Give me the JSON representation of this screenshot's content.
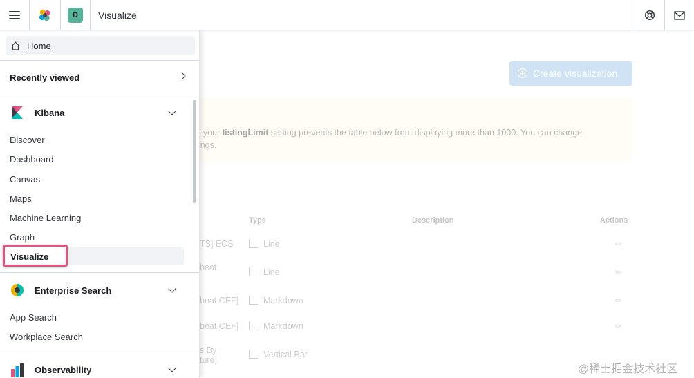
{
  "header": {
    "space_initial": "D",
    "app_title": "Visualize",
    "icons": {
      "menu": "hamburger-icon",
      "logo": "elastic-logo",
      "help": "help-icon",
      "mail": "mail-icon"
    }
  },
  "background": {
    "create_button_label": "Create visualization",
    "callout_line1_prefix": "ut your ",
    "callout_line1_bold": "listingLimit",
    "callout_line1_suffix": " setting prevents the table below from displaying more than 1000. You can change",
    "callout_line2": "ttings.",
    "table_headers": {
      "type": "Type",
      "description": "Description",
      "actions": "Actions"
    },
    "rows": [
      {
        "title_fragment": "TS] ECS",
        "type": "Line"
      },
      {
        "title_fragment": "beat",
        "type": "Line"
      },
      {
        "title_fragment": "beat CEF]",
        "type": "Markdown"
      },
      {
        "title_fragment": "beat CEF]",
        "type": "Markdown"
      },
      {
        "title_fragment": "s By",
        "title_fragment2": "ture]",
        "type": "Vertical Bar"
      }
    ]
  },
  "nav": {
    "home_label": "Home",
    "recently_viewed": "Recently viewed",
    "groups": [
      {
        "title": "Kibana",
        "icon": "kibana-logo",
        "items": [
          "Discover",
          "Dashboard",
          "Canvas",
          "Maps",
          "Machine Learning",
          "Graph"
        ],
        "selected_item": "Visualize"
      },
      {
        "title": "Enterprise Search",
        "icon": "enterprise-search-logo",
        "items": [
          "App Search",
          "Workplace Search"
        ]
      },
      {
        "title": "Observability",
        "icon": "observability-logo"
      }
    ]
  },
  "watermark": "@稀土掘金技术社区",
  "colors": {
    "highlight": "#e2547f",
    "avatar": "#54b399",
    "create_button": "#cfe3f5"
  }
}
